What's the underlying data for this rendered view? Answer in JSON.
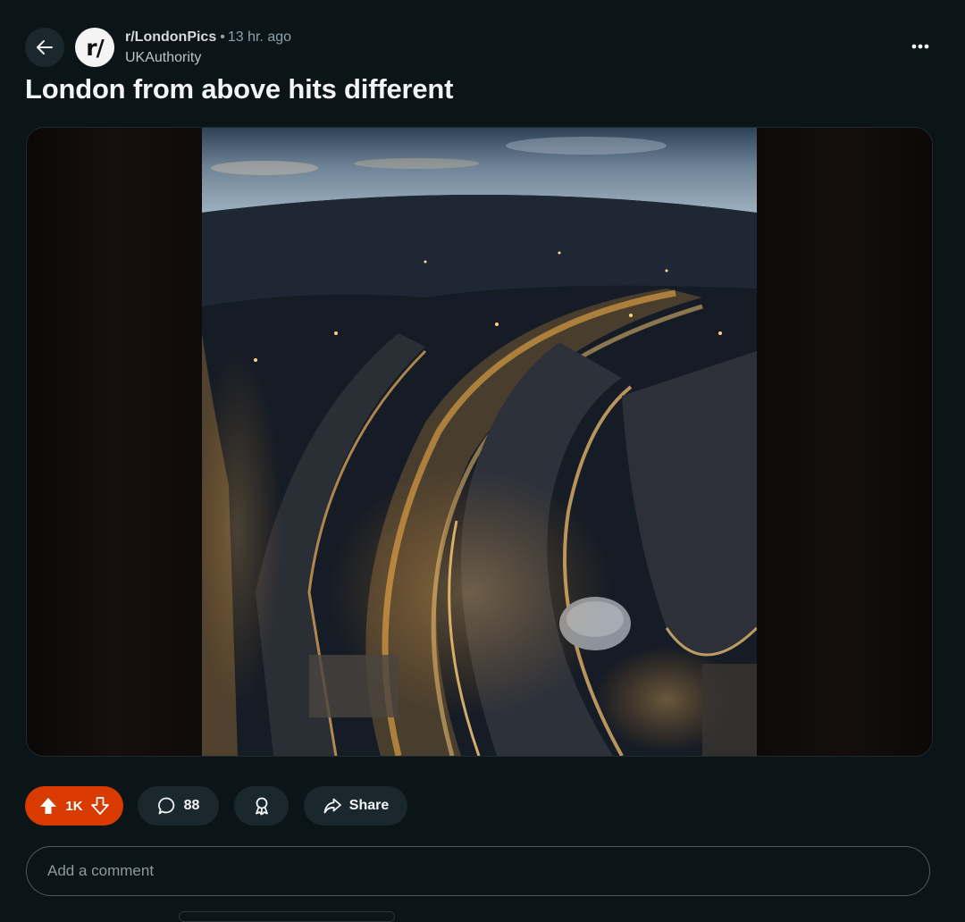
{
  "post": {
    "subreddit": "r/LondonPics",
    "separator": "•",
    "age": "13 hr. ago",
    "author": "UKAuthority",
    "title": "London from above hits different",
    "avatar_text": "r/"
  },
  "actions": {
    "vote_count": "1K",
    "comment_count": "88",
    "share_label": "Share"
  },
  "comment_box": {
    "placeholder": "Add a comment"
  },
  "colors": {
    "background": "#0b1416",
    "upvoted_pill": "#d93a00",
    "pill": "#1a282d",
    "text": "#f2f4f5",
    "muted": "#8ba2ad"
  },
  "icons": {
    "back": "arrow-left-icon",
    "more": "ellipsis-icon",
    "upvote": "upvote-filled-icon",
    "downvote": "downvote-outline-icon",
    "comment": "speech-bubble-icon",
    "award": "award-ribbon-icon",
    "share": "share-arrow-icon"
  }
}
